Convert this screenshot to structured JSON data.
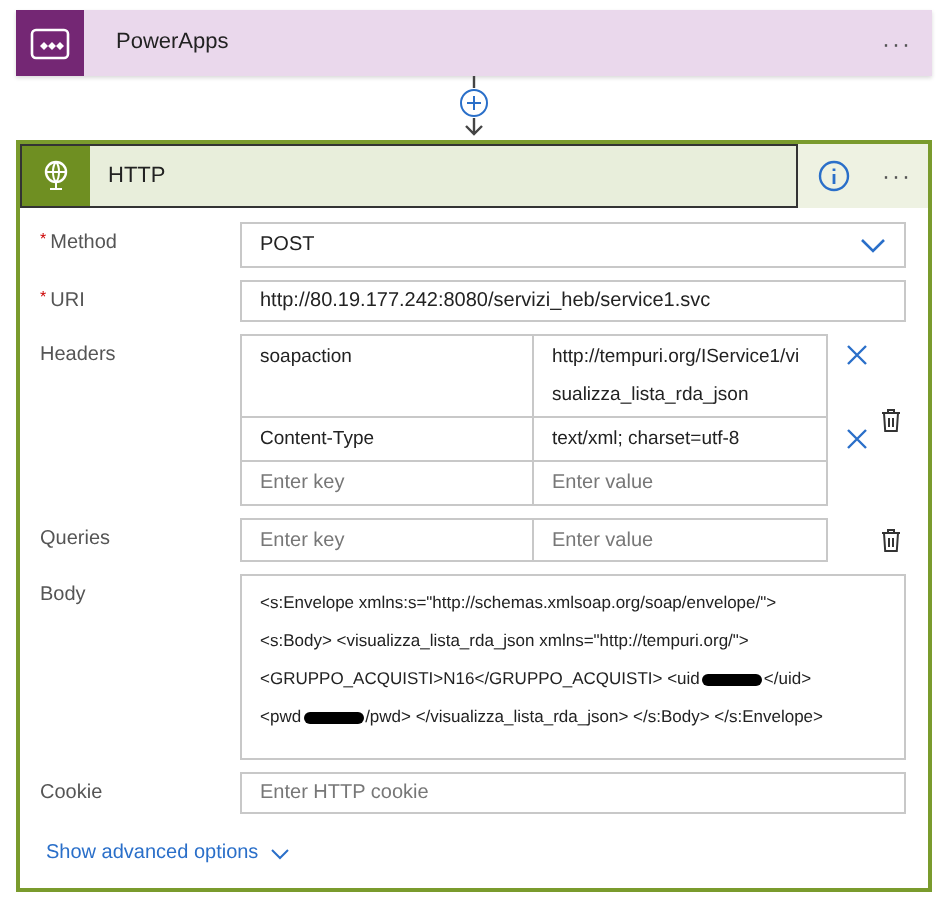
{
  "trigger_card": {
    "title": "PowerApps",
    "menu": "···"
  },
  "action_card": {
    "title": "HTTP",
    "menu": "···"
  },
  "fields": [
    {
      "kind": "select",
      "label": "Method",
      "required_mark": "*",
      "value": "POST"
    },
    {
      "kind": "text",
      "label": "URI",
      "required_mark": "*",
      "value": "http://80.19.177.242:8080/servizi_heb/service1.svc"
    },
    {
      "kind": "pairs",
      "label": "Headers",
      "rows": [
        {
          "key": "soapaction",
          "value": "http://tempuri.org/IService1/visualizza_lista_rda_json",
          "removable": true
        },
        {
          "key": "Content-Type",
          "value": "text/xml; charset=utf-8",
          "removable": true
        },
        {
          "key_placeholder": "Enter key",
          "value_placeholder": "Enter value",
          "removable": false
        }
      ]
    },
    {
      "kind": "pairs",
      "label": "Queries",
      "rows": [
        {
          "key_placeholder": "Enter key",
          "value_placeholder": "Enter value",
          "removable": false
        }
      ]
    },
    {
      "kind": "body",
      "label": "Body",
      "lines": [
        [
          {
            "kind": "text",
            "text": "<s:Envelope xmlns:s=\"http://schemas.xmlsoap.org/soap/envelope/\">"
          }
        ],
        [
          {
            "kind": "text",
            "text": "<s:Body> <visualizza_lista_rda_json xmlns=\"http://tempuri.org/\">"
          }
        ],
        [
          {
            "kind": "text",
            "text": "<GRUPPO_ACQUISTI>N16</GRUPPO_ACQUISTI> <uid"
          },
          {
            "kind": "redacted"
          },
          {
            "kind": "text",
            "text": "</uid>"
          }
        ],
        [
          {
            "kind": "text",
            "text": "<pwd"
          },
          {
            "kind": "redacted"
          },
          {
            "kind": "text",
            "text": "/pwd> </visualizza_lista_rda_json> </s:Body> </s:Envelope>"
          }
        ]
      ]
    },
    {
      "kind": "text",
      "label": "Cookie",
      "placeholder": "Enter HTTP cookie"
    }
  ],
  "advanced_link": "Show advanced options"
}
